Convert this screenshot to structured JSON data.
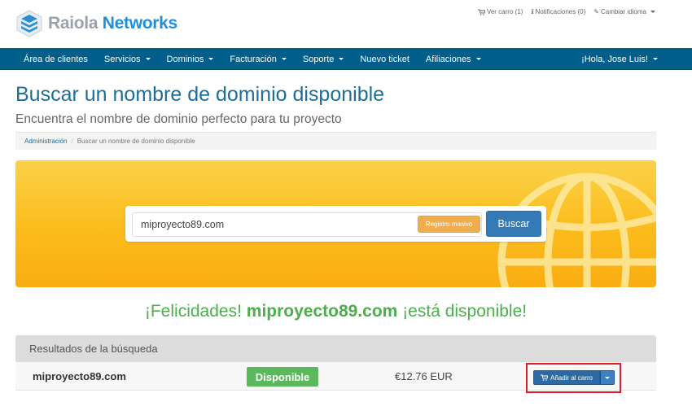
{
  "brand": {
    "name_part1": "Raiola",
    "name_part2": "Networks",
    "color_primary": "#1f8fd8",
    "color_secondary": "#9aa3ad"
  },
  "top_links": {
    "cart": "Ver carro (1)",
    "notifications": "Notificaciones (0)",
    "language": "Cambiar idioma"
  },
  "nav": {
    "items": [
      {
        "label": "Área de clientes",
        "has_dropdown": false
      },
      {
        "label": "Servicios",
        "has_dropdown": true
      },
      {
        "label": "Dominios",
        "has_dropdown": true
      },
      {
        "label": "Facturación",
        "has_dropdown": true
      },
      {
        "label": "Soporte",
        "has_dropdown": true
      },
      {
        "label": "Nuevo ticket",
        "has_dropdown": false
      },
      {
        "label": "Afiliaciones",
        "has_dropdown": true
      }
    ],
    "user": "¡Hola, Jose Luis!",
    "bg_color": "#005e8a"
  },
  "page": {
    "title": "Buscar un nombre de dominio disponible",
    "subtitle": "Encuentra el nombre de dominio perfecto para tu proyecto"
  },
  "breadcrumb": {
    "home": "Administración",
    "current": "Buscar un nombre de dominio disponible"
  },
  "search": {
    "value": "miproyecto89.com",
    "bulk_label": "Registro masivo",
    "button_label": "Buscar"
  },
  "congrats": {
    "prefix": "¡Felicidades!",
    "domain": "miproyecto89.com",
    "suffix": "¡está disponible!"
  },
  "results": {
    "header": "Resultados de la búsqueda",
    "rows": [
      {
        "domain": "miproyecto89.com",
        "status": "Disponible",
        "price": "€12.76 EUR",
        "action": "Añadir al carro"
      }
    ]
  },
  "icons": {
    "logo": "stacked-cubes-icon",
    "cart": "cart-icon",
    "info": "info-icon",
    "language": "translate-icon",
    "globe": "globe-icon"
  }
}
